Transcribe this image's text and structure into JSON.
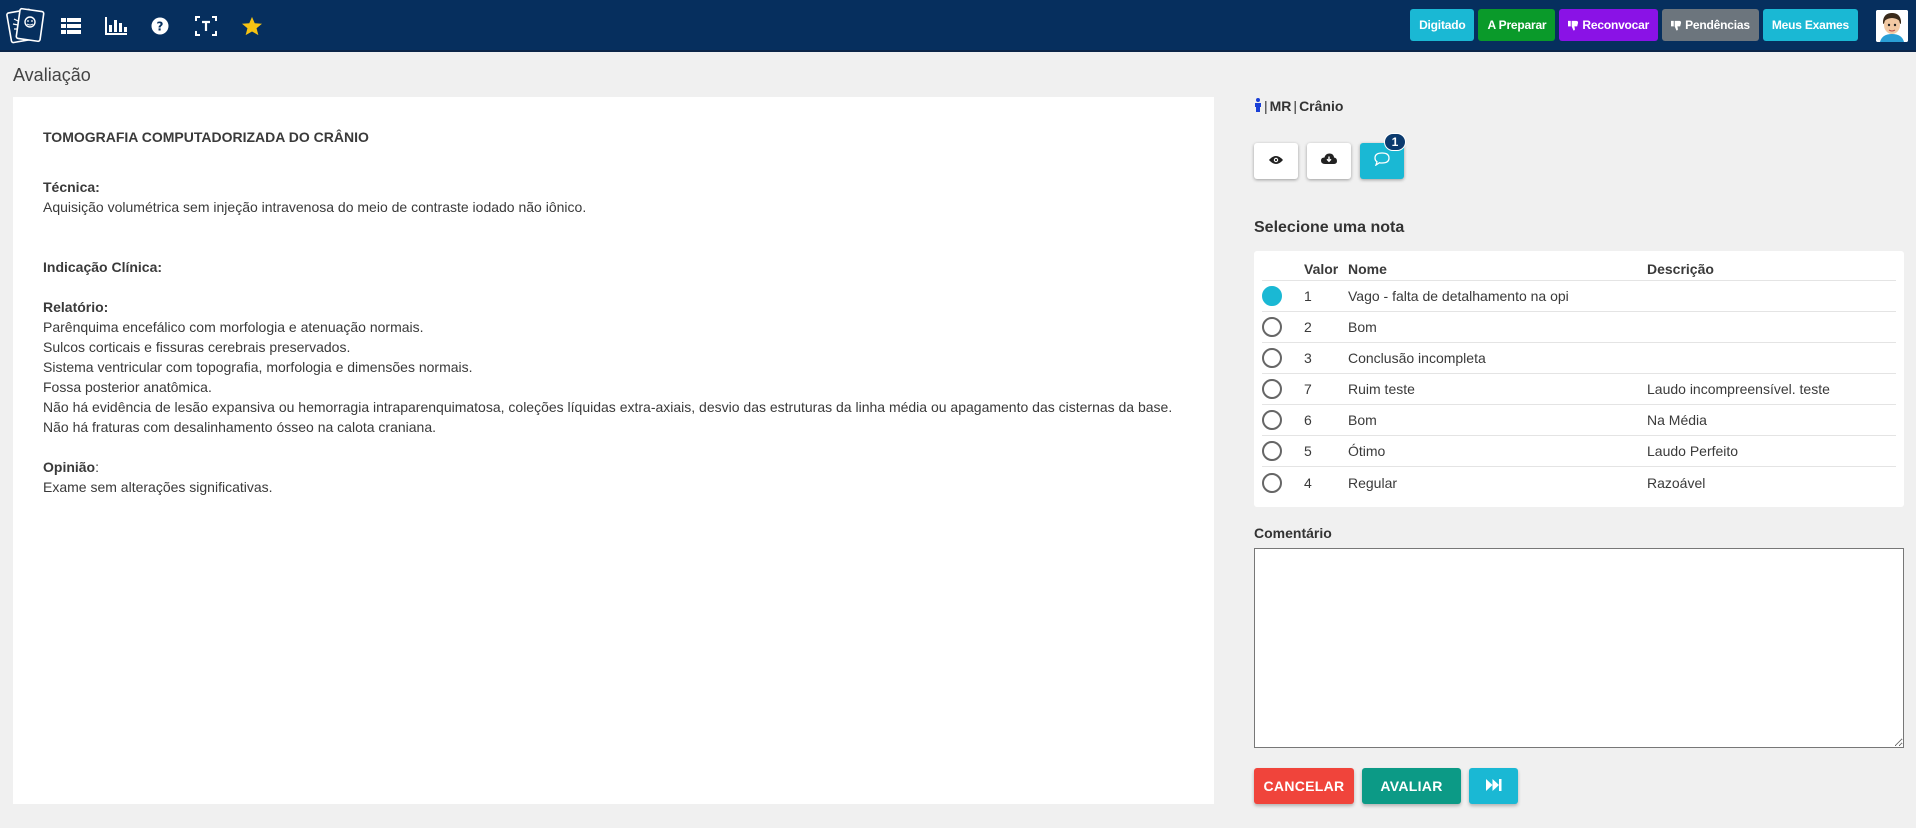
{
  "topbar": {
    "icons": [
      "logo-icon",
      "list-icon",
      "bar-chart-icon",
      "help-icon",
      "text-select-icon",
      "star-icon"
    ],
    "buttons": [
      {
        "label": "Digitado",
        "color": "#1ab8d4",
        "icon": ""
      },
      {
        "label": "A Preparar",
        "color": "#0a9a2a",
        "icon": ""
      },
      {
        "label": "Reconvocar",
        "color": "#8a12e6",
        "icon": "thumbs-down-icon"
      },
      {
        "label": "Pendências",
        "color": "#6c757d",
        "icon": "thumbs-down-icon"
      },
      {
        "label": "Meus Exames",
        "color": "#1ab8d4",
        "icon": ""
      }
    ]
  },
  "page": {
    "title": "Avaliação"
  },
  "report": {
    "title": "TOMOGRAFIA COMPUTADORIZADA DO CRÂNIO",
    "tecnica_label": "Técnica:",
    "tecnica_text": "Aquisição volumétrica sem injeção intravenosa do meio de contraste iodado não iônico.",
    "indicacao_label": "Indicação Clínica:",
    "relatorio_label": "Relatório:",
    "relatorio_lines": [
      "Parênquima encefálico com morfologia e atenuação normais.",
      "Sulcos corticais e fissuras cerebrais preservados.",
      "Sistema ventricular com topografia, morfologia e dimensões normais.",
      "Fossa posterior anatômica.",
      "Não há evidência de lesão expansiva ou hemorragia intraparenquimatosa, coleções líquidas extra-axiais, desvio das estruturas da linha média ou apagamento das cisternas da base.",
      "Não há fraturas com desalinhamento ósseo na calota craniana."
    ],
    "opiniao_label": "Opinião",
    "opiniao_colon": ":",
    "opiniao_text": "Exame sem alterações significativas."
  },
  "exam": {
    "modality": "MR",
    "region": "Crânio",
    "pipe": "|"
  },
  "actions": {
    "badge_count": "1"
  },
  "grades": {
    "title": "Selecione uma nota",
    "headers": {
      "valor": "Valor",
      "nome": "Nome",
      "descricao": "Descrição"
    },
    "rows": [
      {
        "valor": "1",
        "nome": "Vago - falta de detalhamento na opi",
        "descricao": "",
        "selected": true
      },
      {
        "valor": "2",
        "nome": "Bom",
        "descricao": "",
        "selected": false
      },
      {
        "valor": "3",
        "nome": "Conclusão incompleta",
        "descricao": "",
        "selected": false
      },
      {
        "valor": "7",
        "nome": "Ruim teste",
        "descricao": "Laudo incompreensível. teste",
        "selected": false
      },
      {
        "valor": "6",
        "nome": "Bom",
        "descricao": "Na Média",
        "selected": false
      },
      {
        "valor": "5",
        "nome": "Ótimo",
        "descricao": "Laudo Perfeito",
        "selected": false
      },
      {
        "valor": "4",
        "nome": "Regular",
        "descricao": "Razoável",
        "selected": false
      }
    ]
  },
  "comment": {
    "label": "Comentário",
    "value": ""
  },
  "buttons": {
    "cancel": {
      "label": "CANCELAR",
      "color": "#f0443b"
    },
    "evaluate": {
      "label": "AVALIAR",
      "color": "#0c9a86"
    },
    "next_icon": "skip-forward-icon"
  }
}
